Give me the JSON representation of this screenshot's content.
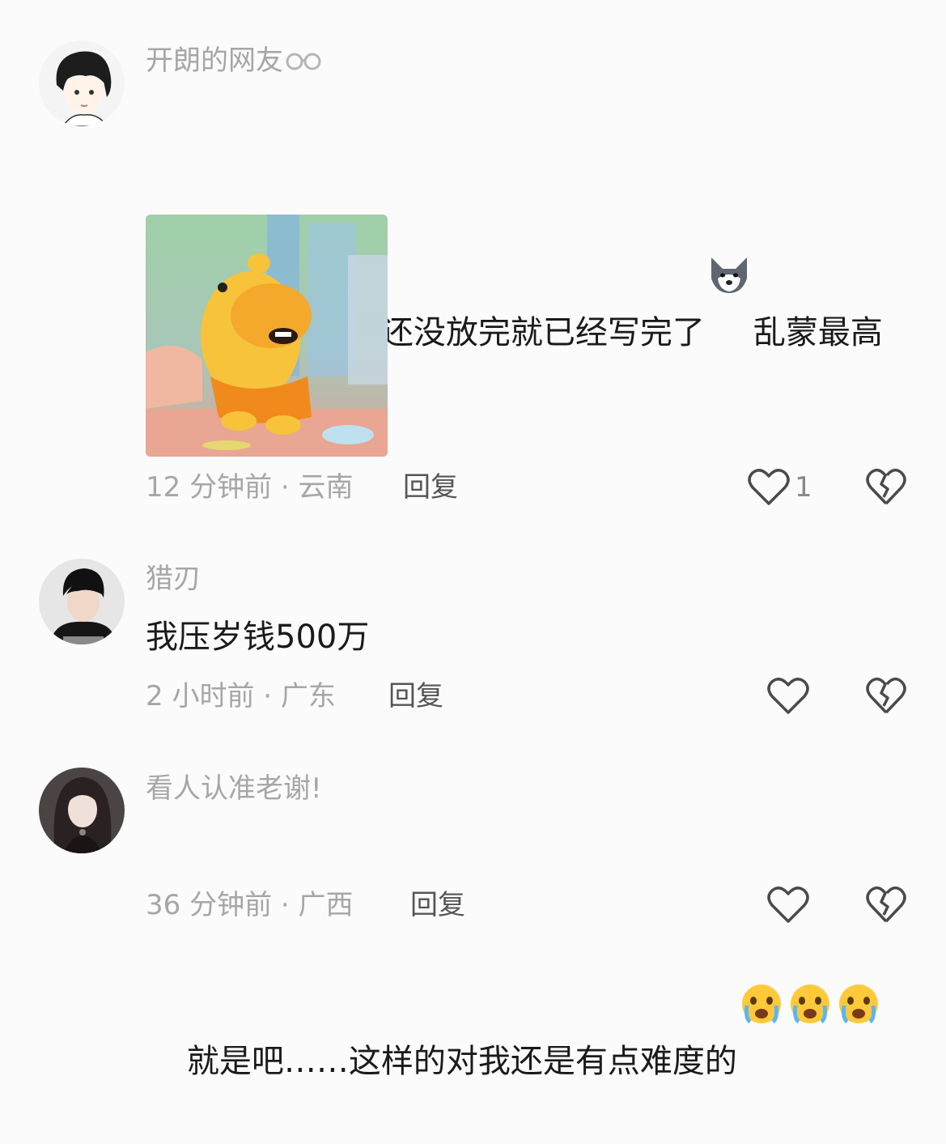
{
  "comments": [
    {
      "username": "开朗的网友",
      "text_before_emoji": "以前初中听力还没放完就已经写完了",
      "text_after_emoji": "乱蒙最高蒙五十分",
      "inline_emoji": "wolf-emoji",
      "time": "12 分钟前 · 云南",
      "reply_label": "回复",
      "like_count": "1",
      "has_sticker": true,
      "sticker": "yellow-hippo-cartoon-sticker"
    },
    {
      "username": "猎刃",
      "text": "我压岁钱500万",
      "time": "2 小时前 · 广东",
      "reply_label": "回复",
      "like_count": ""
    },
    {
      "username": "看人认准老谢!",
      "text": "就是吧……这样的对我还是有点难度的",
      "trailing_emojis": [
        "crying-emoji",
        "crying-emoji",
        "crying-emoji"
      ],
      "time": "36 分钟前 · 广西",
      "reply_label": "回复",
      "like_count": ""
    }
  ],
  "icons": {
    "like": "heart-outline-icon",
    "dislike": "broken-heart-icon",
    "badge": "glasses-badge-icon"
  },
  "colors": {
    "background": "#fbfbfb",
    "username": "#a6a6a6",
    "body_text": "#1a1a1a",
    "meta_text": "#a6a6a6",
    "reply_text": "#555555",
    "icon_stroke": "#4a4a4a"
  }
}
